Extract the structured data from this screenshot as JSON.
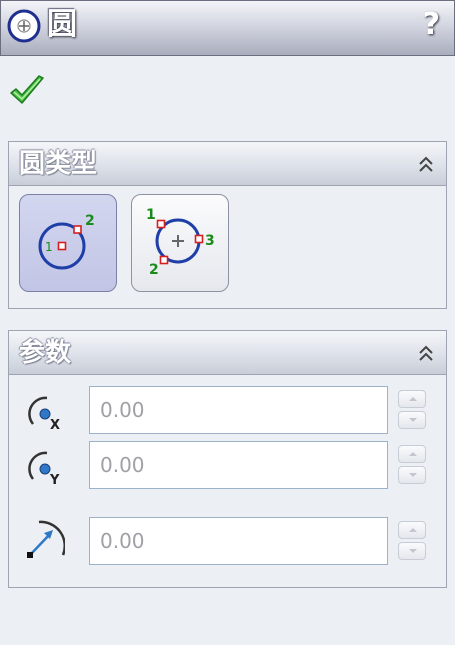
{
  "titlebar": {
    "title": "圆",
    "icon": "circle-plus-icon",
    "help_label": "?"
  },
  "ok_icon": "green-checkmark-icon",
  "circle_type_group": {
    "title": "圆类型",
    "collapse_icon": "double-chevron-up-icon",
    "buttons": [
      {
        "name": "center-radius-circle",
        "icon": "center-circle-icon",
        "labels": [
          "1",
          "2"
        ],
        "selected": true
      },
      {
        "name": "perimeter-circle",
        "icon": "perimeter-circle-icon",
        "labels": [
          "1",
          "3",
          "2"
        ],
        "selected": false
      }
    ]
  },
  "parameters_group": {
    "title": "参数",
    "collapse_icon": "double-chevron-up-icon",
    "fields": [
      {
        "name": "center-x",
        "icon": "center-x-icon",
        "icon_label": "X",
        "value": "0.00"
      },
      {
        "name": "center-y",
        "icon": "center-y-icon",
        "icon_label": "Y",
        "value": "0.00"
      },
      {
        "name": "radius",
        "icon": "radius-icon",
        "value": "0.00"
      }
    ]
  },
  "colors": {
    "accent_blue": "#1f3fa8",
    "point_red": "#d42020",
    "label_green": "#1a8a1a",
    "check_green": "#3bb53b"
  }
}
